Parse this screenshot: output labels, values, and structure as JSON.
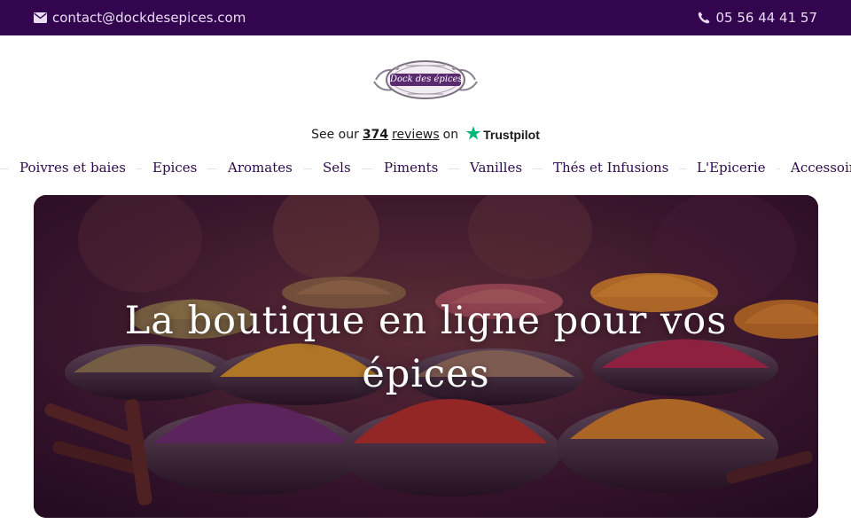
{
  "topbar": {
    "email": "contact@dockdesepices.com",
    "phone": "05 56 44 41 57",
    "email_icon": "envelope-icon",
    "phone_icon": "phone-icon",
    "background": "#33054f"
  },
  "logo": {
    "text": "Dock des épices"
  },
  "trustpilot": {
    "prefix": "See our",
    "count": "374",
    "reviews": "reviews",
    "on": "on",
    "brand": "Trustpilot",
    "star_color": "#00b67a"
  },
  "nav": {
    "items": [
      {
        "label": "Poivres et baies"
      },
      {
        "label": "Epices"
      },
      {
        "label": "Aromates"
      },
      {
        "label": "Sels"
      },
      {
        "label": "Piments"
      },
      {
        "label": "Vanilles"
      },
      {
        "label": "Thés et Infusions"
      },
      {
        "label": "L'Epicerie"
      },
      {
        "label": "Accessoires"
      }
    ]
  },
  "hero": {
    "title": "La boutique en ligne pour vos épices"
  }
}
